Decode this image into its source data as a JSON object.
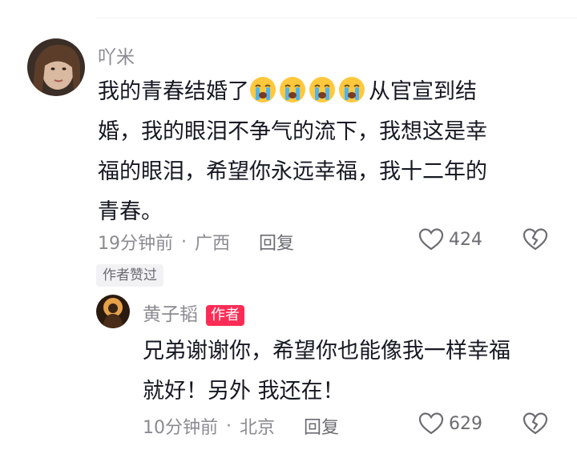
{
  "comment": {
    "username": "吖米",
    "text_part1": "我的青春结婚了",
    "emojis": [
      "loudly-crying-face",
      "loudly-crying-face",
      "loudly-crying-face",
      "loudly-crying-face"
    ],
    "text_lines": [
      "从官宣到结",
      "婚，我的眼泪不争气的流下，我想这是幸",
      "福的眼泪，希望你永远幸福，我十二年的",
      "青春。"
    ],
    "time": "19分钟前",
    "location": "广西",
    "reply_label": "回复",
    "like_count": "424",
    "author_liked_badge": "作者赞过"
  },
  "reply": {
    "username": "黄子韬",
    "author_tag": "作者",
    "text_lines": [
      "兄弟谢谢你，希望你也能像我一样幸福",
      "就好！另外 我还在！"
    ],
    "time": "10分钟前",
    "location": "北京",
    "reply_label": "回复",
    "like_count": "629"
  },
  "colors": {
    "accent": "#fe2c55",
    "meta_text": "#8a8b91",
    "body_text": "#161823"
  }
}
